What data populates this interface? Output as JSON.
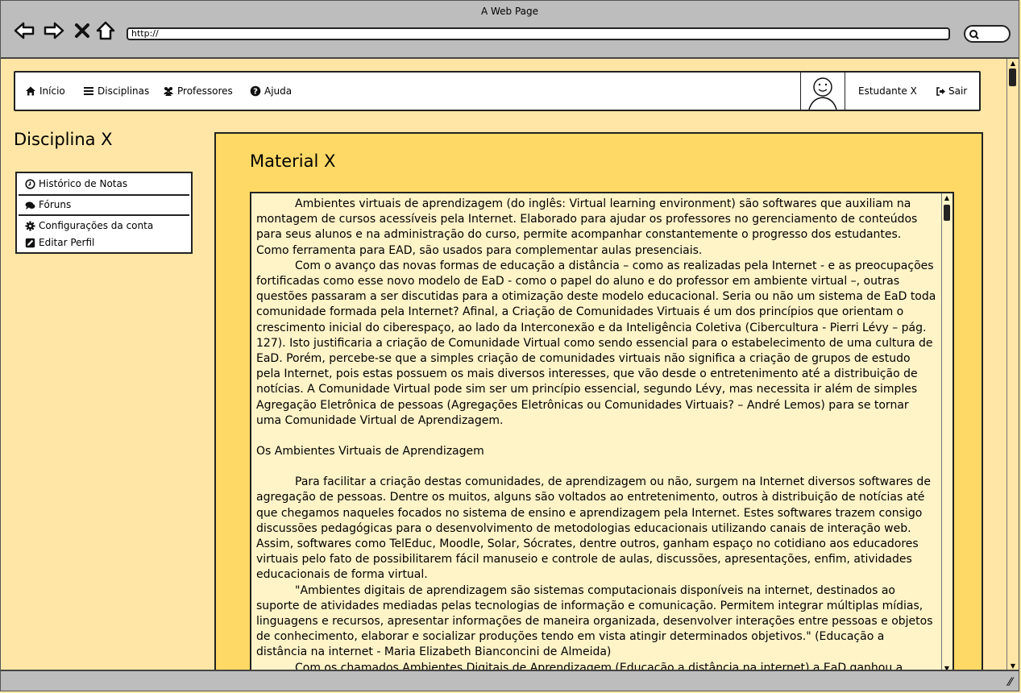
{
  "browser": {
    "title": "A Web Page",
    "url": "http://",
    "icons": [
      "back-arrow-icon",
      "forward-arrow-icon",
      "close-icon",
      "home-icon",
      "search-icon"
    ]
  },
  "nav": {
    "items": [
      {
        "label": "Início",
        "icon": "home-icon"
      },
      {
        "label": "Disciplinas",
        "icon": "list-icon"
      },
      {
        "label": "Professores",
        "icon": "users-icon"
      },
      {
        "label": "Ajuda",
        "icon": "question-icon"
      }
    ],
    "user": "Estudante X",
    "logout": "Sair"
  },
  "course": {
    "title": "Disciplina X"
  },
  "sidebar": {
    "items": [
      {
        "label": "Histórico de Notas",
        "icon": "clock-icon"
      },
      {
        "label": "Fóruns",
        "icon": "comments-icon"
      },
      {
        "label": "Configurações da conta",
        "icon": "gear-icon"
      },
      {
        "label": "Editar Perfil",
        "icon": "edit-icon"
      }
    ]
  },
  "material": {
    "title": "Material X",
    "paragraphs": [
      "Ambientes virtuais de aprendizagem (do inglês: Virtual learning environment) são softwares que auxiliam na montagem de cursos acessíveis pela Internet. Elaborado para ajudar os professores no gerenciamento de conteúdos para seus alunos e na administração do curso, permite acompanhar constantemente o progresso dos estudantes. Como ferramenta para EAD, são usados para complementar aulas presenciais.",
      "Com o avanço das novas formas de educação a distância – como as realizadas pela Internet - e as preocupações fortificadas como esse novo modelo de EaD - como o papel do aluno e do professor em ambiente virtual –, outras questões passaram a ser discutidas para a otimização deste modelo educacional. Seria ou não um sistema de EaD toda comunidade formada pela Internet? Afinal, a Criação de Comunidades Virtuais é um dos princípios que orientam o crescimento inicial do ciberespaço, ao lado da Interconexão e da Inteligência Coletiva (Cibercultura - Pierri Lévy – pág. 127). Isto justificaria a criação de Comunidade Virtual como sendo essencial para o estabelecimento de uma cultura de EaD. Porém, percebe-se que a simples criação de comunidades virtuais não significa a criação de grupos de estudo pela Internet, pois estas possuem os mais diversos interesses, que vão desde o entretenimento até a distribuição de notícias. A Comunidade Virtual pode sim ser um princípio essencial, segundo Lévy, mas necessita ir além de simples Agregação Eletrônica de pessoas (Agregações Eletrônicas ou Comunidades Virtuais? – André Lemos) para se tornar uma Comunidade Virtual de Aprendizagem.",
      "Os Ambientes Virtuais de Aprendizagem",
      "Para facilitar a criação destas comunidades, de aprendizagem ou não, surgem na Internet diversos softwares de agregação de pessoas. Dentre os muitos, alguns são voltados ao entretenimento, outros à distribuição de notícias até que chegamos naqueles focados no sistema de ensino e aprendizagem pela Internet. Estes softwares trazem consigo discussões pedagógicas para o desenvolvimento de metodologias educacionais utilizando canais de interação web. Assim, softwares como TelEduc, Moodle, Solar, Sócrates, dentre outros, ganham espaço no cotidiano aos educadores virtuais pelo fato de possibilitarem fácil manuseio e controle de aulas, discussões, apresentações, enfim, atividades educacionais de forma virtual.",
      "\"Ambientes digitais de aprendizagem são sistemas computacionais disponíveis na internet, destinados ao suporte de atividades mediadas pelas tecnologias de informação e comunicação. Permitem integrar múltiplas mídias, linguagens e recursos, apresentar informações de maneira organizada, desenvolver interações entre pessoas e objetos de conhecimento, elaborar e socializar produções tendo em vista atingir determinados objetivos.\" (Educação a distância na internet - Maria Elizabeth Bianconcini de Almeida)",
      "Com os chamados Ambientes Digitais de Aprendizagem (Educação a distância na internet) a EaD ganhou a"
    ]
  }
}
